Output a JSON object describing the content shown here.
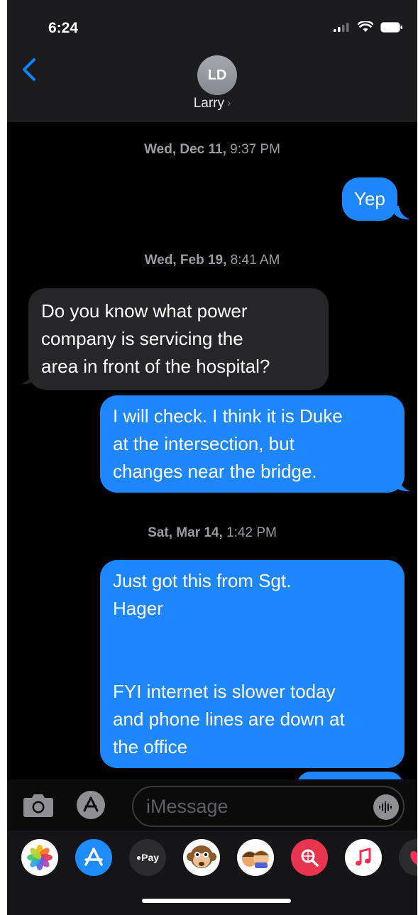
{
  "status_bar": {
    "time": "6:24"
  },
  "header": {
    "avatar_initials": "LD",
    "contact_name": "Larry",
    "contact_chevron": "›"
  },
  "conversation": [
    {
      "kind": "timestamp",
      "date": "Wed, Dec 11,",
      "time": "9:37 PM"
    },
    {
      "kind": "message",
      "direction": "outgoing",
      "text": "Yep"
    },
    {
      "kind": "timestamp",
      "date": "Wed, Feb 19,",
      "time": "8:41 AM"
    },
    {
      "kind": "message",
      "direction": "incoming",
      "lines": [
        "Do you know what power",
        "company is servicing the",
        "area in front of the hospital?"
      ]
    },
    {
      "kind": "message",
      "direction": "outgoing",
      "lines": [
        "I will check. I think it is Duke",
        "at the intersection, but",
        "changes near the bridge."
      ]
    },
    {
      "kind": "timestamp",
      "date": "Sat, Mar 14,",
      "time": "1:42 PM"
    },
    {
      "kind": "message",
      "direction": "outgoing",
      "lines": [
        "Just got this from Sgt.",
        "Hager",
        "",
        "",
        "FYI internet is slower today",
        "and phone lines are down at",
        "the office"
      ]
    }
  ],
  "compose": {
    "placeholder": "iMessage"
  },
  "app_drawer": {
    "apps": [
      {
        "icon": "photos-icon"
      },
      {
        "icon": "app-store-icon"
      },
      {
        "icon": "apple-pay-icon",
        "label": "Pay"
      },
      {
        "icon": "memoji-monkey-icon"
      },
      {
        "icon": "memoji-stickers-icon"
      },
      {
        "icon": "web-search-icon"
      },
      {
        "icon": "music-icon"
      },
      {
        "icon": "digital-touch-icon"
      }
    ]
  },
  "colors": {
    "outgoing_bubble": "#1e86ff",
    "incoming_bubble": "#262628",
    "background": "#000000",
    "accent": "#0a84ff"
  }
}
